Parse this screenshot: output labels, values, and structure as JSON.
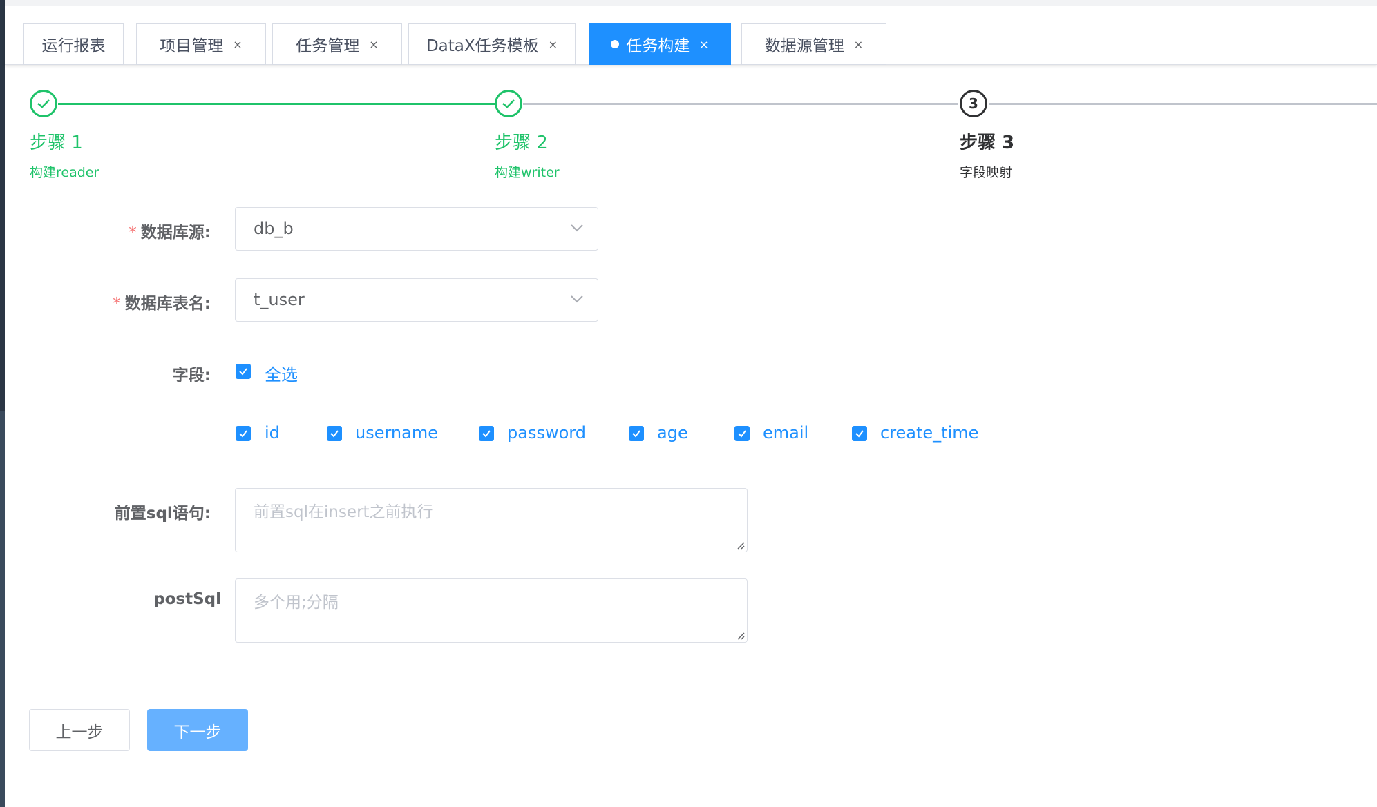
{
  "tabs": [
    {
      "label": "运行报表",
      "closable": false,
      "active": false
    },
    {
      "label": "项目管理",
      "closable": true,
      "active": false
    },
    {
      "label": "任务管理",
      "closable": true,
      "active": false
    },
    {
      "label": "DataX任务模板",
      "closable": true,
      "active": false
    },
    {
      "label": "任务构建",
      "closable": true,
      "active": true
    },
    {
      "label": "数据源管理",
      "closable": true,
      "active": false
    }
  ],
  "close_glyph": "×",
  "steps": [
    {
      "title": "步骤 1",
      "desc": "构建reader",
      "status": "done"
    },
    {
      "title": "步骤 2",
      "desc": "构建writer",
      "status": "done"
    },
    {
      "title": "步骤 3",
      "desc": "字段映射",
      "status": "current",
      "number": "3"
    }
  ],
  "form": {
    "datasource": {
      "label": "数据库源:",
      "value": "db_b",
      "required": true
    },
    "table": {
      "label": "数据库表名:",
      "value": "t_user",
      "required": true
    },
    "required_mark": "*",
    "fields": {
      "label": "字段:",
      "select_all": "全选",
      "items": [
        "id",
        "username",
        "password",
        "age",
        "email",
        "create_time"
      ]
    },
    "pre_sql": {
      "label": "前置sql语句:",
      "placeholder": "前置sql在insert之前执行"
    },
    "post_sql": {
      "label": "postSql",
      "placeholder": "多个用;分隔"
    }
  },
  "buttons": {
    "prev": "上一步",
    "next": "下一步"
  },
  "colors": {
    "primary": "#1e90ff",
    "success": "#1fc36a",
    "danger": "#f56c6c",
    "next_button": "#66b1ff"
  }
}
